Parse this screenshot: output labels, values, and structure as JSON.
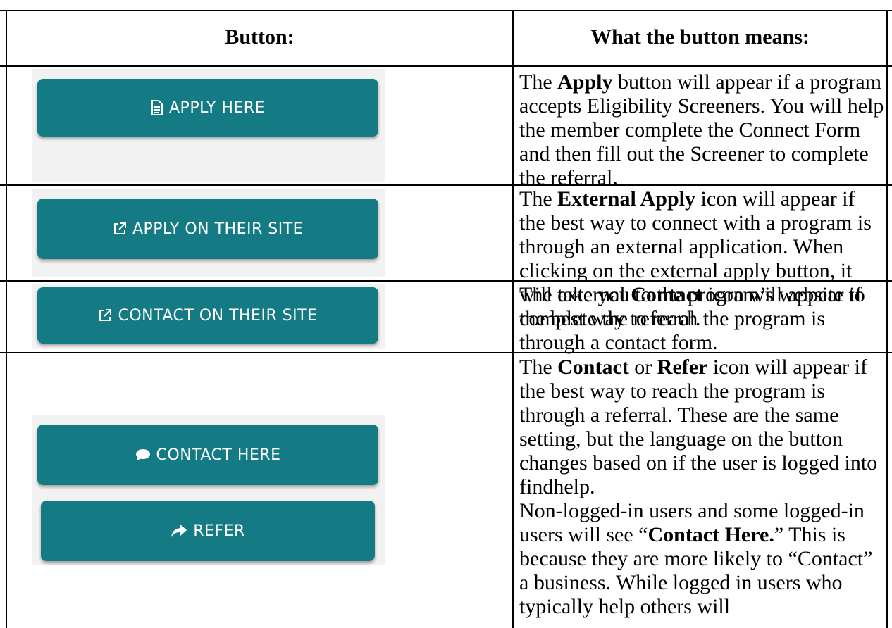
{
  "header": {
    "col1": "Button:",
    "col2": "What the button means:"
  },
  "rows": [
    {
      "button_label": "APPLY HERE",
      "button_icon": "document-icon",
      "desc": {
        "p1": "The ",
        "b1": "Apply",
        "p2": " button will appear if a program accepts Eligibility Screeners. You will help the member complete the Connect Form and then fill out the Screener to complete the referral."
      }
    },
    {
      "button_label": "APPLY ON THEIR SITE",
      "button_icon": "external-link-icon",
      "desc": {
        "p1": "The ",
        "b1": "External Apply",
        "p2": " icon will appear if the best way to connect with a program is through an external application. When clicking on the external apply button, it will take you to the program’s website to complete the referral."
      }
    },
    {
      "button_label": "CONTACT ON THEIR SITE",
      "button_icon": "external-link-icon",
      "desc": {
        "p1": "The external ",
        "b1": "Contact",
        "p2": " icon will appear if the best way to reach the program is through a contact form."
      }
    },
    {
      "button_label": "CONTACT HERE",
      "button_icon": "speech-bubble-icon",
      "button2_label": "REFER",
      "button2_icon": "share-arrow-icon",
      "desc": {
        "p1": "The ",
        "b1": "Contact",
        "p2": " or ",
        "b2": "Refer",
        "p3": " icon will appear if the best way to reach the program is through a referral. These are the same setting, but the language on the button changes based on if the user is logged into findhelp.",
        "p4": "Non-logged-in users and some logged-in users will see “",
        "b3": "Contact Here.",
        "p5": "” This is because they are more likely to “Contact” a business. While logged in users who typically help others will"
      }
    }
  ],
  "colors": {
    "button": "#147b85",
    "text": "#ffffff",
    "border": "#000000"
  }
}
